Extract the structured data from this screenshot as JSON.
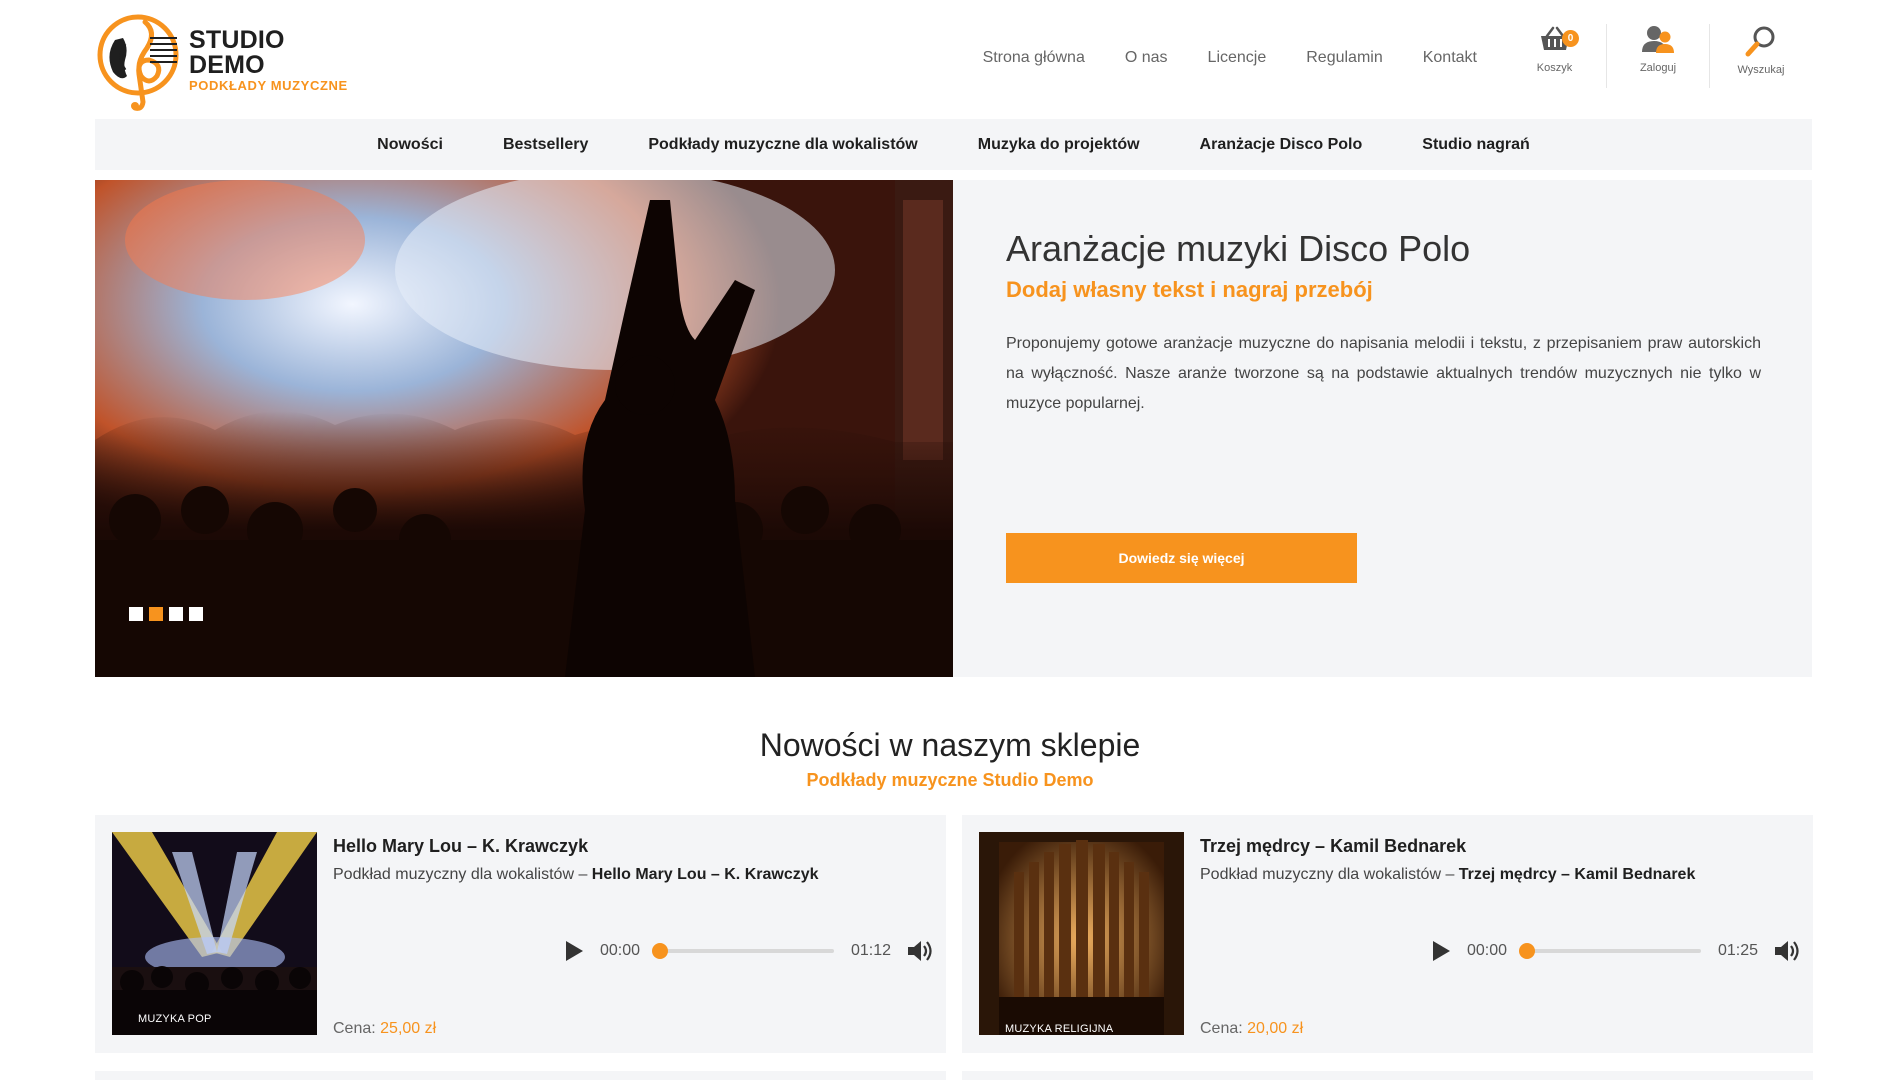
{
  "brand": {
    "title": "STUDIO DEMO",
    "subtitle": "PODKŁADY MUZYCZNE",
    "accent_color": "#f7931e"
  },
  "topnav": [
    {
      "label": "Strona główna"
    },
    {
      "label": "O nas"
    },
    {
      "label": "Licencje"
    },
    {
      "label": "Regulamin"
    },
    {
      "label": "Kontakt"
    }
  ],
  "icons": {
    "cart": {
      "label": "Koszyk",
      "count": "0",
      "icon": "basket-icon"
    },
    "login": {
      "label": "Zaloguj",
      "icon": "users-icon"
    },
    "search": {
      "label": "Wyszukaj",
      "icon": "magnifier-icon"
    }
  },
  "mainnav": [
    {
      "label": "Nowości"
    },
    {
      "label": "Bestsellery"
    },
    {
      "label": "Podkłady muzyczne dla wokalistów"
    },
    {
      "label": "Muzyka do projektów"
    },
    {
      "label": "Aranżacje Disco Polo"
    },
    {
      "label": "Studio nagrań"
    }
  ],
  "hero": {
    "title": "Aranżacje muzyki Disco Polo",
    "subtitle": "Dodaj własny tekst i nagraj przebój",
    "description": "Proponujemy gotowe aranżacje muzyczne do napisania melodii i tekstu, z przepisaniem praw autorskich na wyłączność. Nasze aranże tworzone są na podstawie aktualnych trendów muzycznych nie tylko w muzyce popularnej.",
    "button_label": "Dowiedz się więcej",
    "slides_total": 4,
    "active_slide": 2
  },
  "section": {
    "title": "Nowości w naszym sklepie",
    "subtitle": "Podkłady muzyczne Studio Demo"
  },
  "products": [
    {
      "title": "Hello Mary Lou – K. Krawczyk",
      "desc_prefix": "Podkład muzyczny dla wokalistów – ",
      "desc_bold": "Hello Mary Lou – K. Krawczyk",
      "category": "MUZYKA POP",
      "time_current": "00:00",
      "time_total": "01:12",
      "progress": 0,
      "price_label": "Cena: ",
      "price_value": "25,00 zł"
    },
    {
      "title": "Trzej mędrcy – Kamil Bednarek",
      "desc_prefix": "Podkład muzyczny dla wokalistów – ",
      "desc_bold": "Trzej mędrcy – Kamil Bednarek",
      "category": "MUZYKA RELIGIJNA",
      "time_current": "00:00",
      "time_total": "01:25",
      "progress": 0,
      "price_label": "Cena: ",
      "price_value": "20,00 zł"
    }
  ]
}
